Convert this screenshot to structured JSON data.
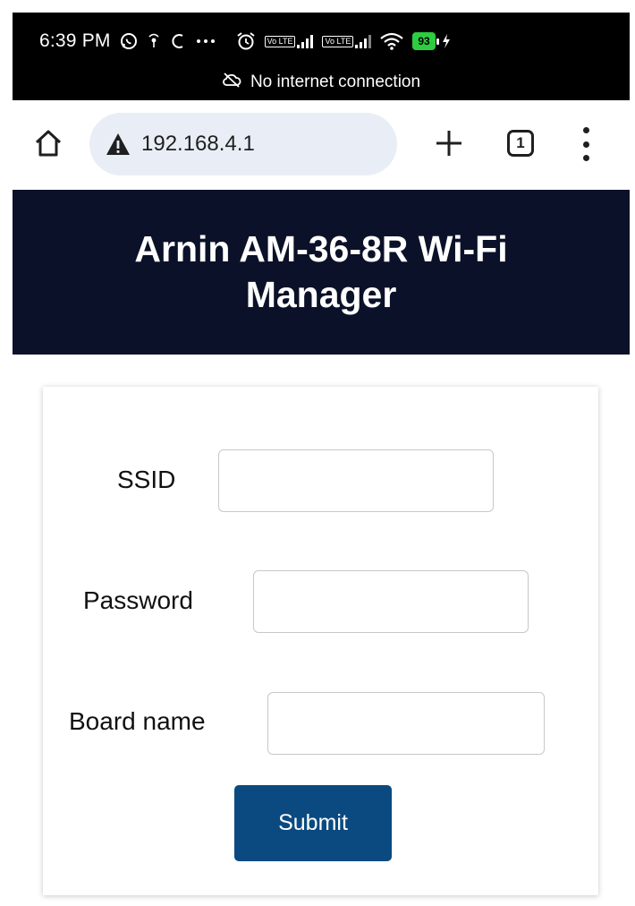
{
  "status_bar": {
    "time": "6:39 PM",
    "lte_label": "Vo LTE",
    "battery_level": "93",
    "notice_text": "No internet connection",
    "icons": [
      "whatsapp-icon",
      "hotspot-icon",
      "sync-icon",
      "more-dots-icon",
      "alarm-icon",
      "signal-icon",
      "wifi-icon",
      "battery-icon",
      "charging-icon",
      "cloud-off-icon"
    ]
  },
  "browser": {
    "url": "192.168.4.1",
    "tab_count": "1",
    "icons": [
      "home-icon",
      "warning-icon",
      "plus-icon",
      "tabs-icon",
      "menu-icon"
    ]
  },
  "header": {
    "title": "Arnin AM-36-8R Wi-Fi Manager",
    "background": "#0b1128"
  },
  "form": {
    "fields": [
      {
        "label": "SSID",
        "value": ""
      },
      {
        "label": "Password",
        "value": ""
      },
      {
        "label": "Board name",
        "value": ""
      }
    ],
    "submit_label": "Submit",
    "accent": "#0a4a80"
  }
}
